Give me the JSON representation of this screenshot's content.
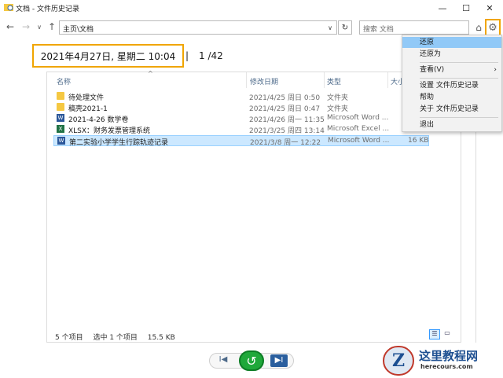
{
  "window": {
    "title": "文档 - 文件历史记录",
    "minimize": "—",
    "maximize": "☐",
    "close": "✕"
  },
  "nav": {
    "back": "←",
    "forward": "→",
    "up": "↑",
    "address": "主页\\文档",
    "address_drop": "∨",
    "refresh": "↻",
    "search_placeholder": "搜索 文档",
    "home": "⌂",
    "settings": "⚙"
  },
  "banner": {
    "date": "2021年4月27日, 星期二 10:04",
    "separator": "|",
    "page": "1 /42"
  },
  "columns": {
    "name": "名称",
    "modified": "修改日期",
    "type": "类型",
    "size": "大小",
    "sort_arrow": "^"
  },
  "files": [
    {
      "name": "待处理文件",
      "modified": "2021/4/25 周日 0:50",
      "type": "文件夹",
      "size": "",
      "icon": "folder-icon"
    },
    {
      "name": "稿壳2021-1",
      "modified": "2021/4/25 周日 0:47",
      "type": "文件夹",
      "size": "",
      "icon": "folder-icon"
    },
    {
      "name": "2021-4-26 数学卷",
      "modified": "2021/4/26 周一 11:35",
      "type": "Microsoft Word ...",
      "size": "",
      "icon": "word-doc-icon"
    },
    {
      "name": "XLSX：财务发票管理系统",
      "modified": "2021/3/25 周四 13:14",
      "type": "Microsoft Excel ...",
      "size": "",
      "icon": "excel-doc-icon"
    },
    {
      "name": "第二实验小学学生行踪轨迹记录",
      "modified": "2021/3/8 周一 12:22",
      "type": "Microsoft Word ...",
      "size": "16 KB",
      "icon": "word-doc-icon"
    }
  ],
  "status": {
    "count": "5 个项目",
    "selected": "选中 1 个项目",
    "selsize": "15.5 KB"
  },
  "controls": {
    "prev": "I◀",
    "restore": "↺",
    "next": "▶I"
  },
  "menu": {
    "items": [
      {
        "label": "还原",
        "hot": true
      },
      {
        "label": "还原为",
        "hot": false
      },
      {
        "label": "查看(V)",
        "hot": false,
        "arrow": "›"
      },
      {
        "label": "设置 文件历史记录",
        "hot": false
      },
      {
        "label": "帮助",
        "hot": false
      },
      {
        "label": "关于 文件历史记录",
        "hot": false
      },
      {
        "label": "退出",
        "hot": false
      }
    ]
  },
  "watermark": {
    "cn": "这里教程网",
    "en": "herecours.com"
  },
  "colors": {
    "highlight_box": "#f0a500",
    "selection": "#cce8ff",
    "restore_green": "#1fa83a",
    "menu_hot": "#91c9f7"
  }
}
